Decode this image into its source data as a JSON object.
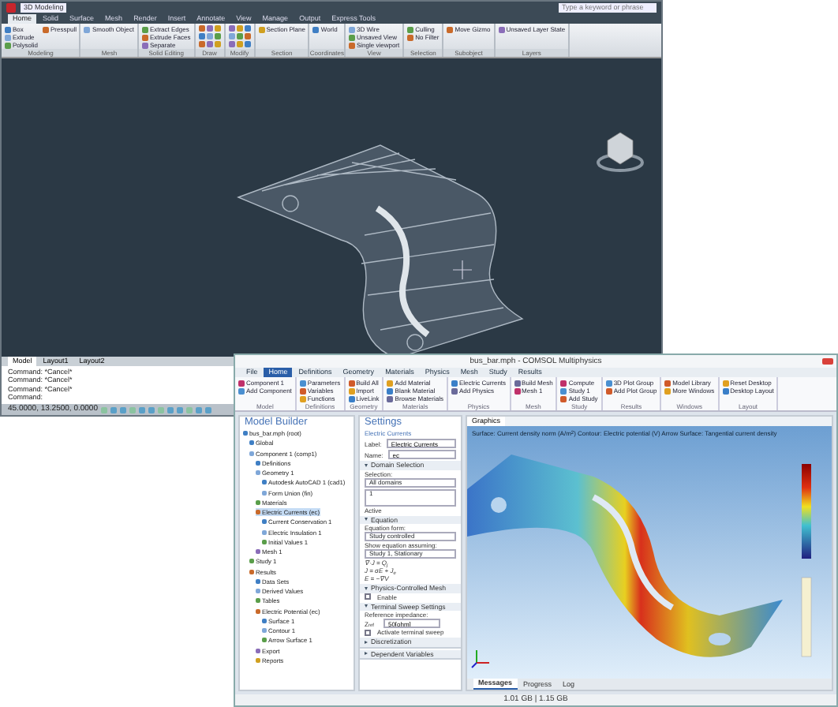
{
  "cad_window": {
    "workspace": "3D Modeling",
    "search_placeholder": "Type a keyword or phrase",
    "tabs": [
      {
        "label": "Home",
        "selected": true
      },
      {
        "label": "Solid",
        "selected": false
      },
      {
        "label": "Surface",
        "selected": false
      },
      {
        "label": "Mesh",
        "selected": false
      },
      {
        "label": "Render",
        "selected": false
      },
      {
        "label": "Insert",
        "selected": false
      },
      {
        "label": "Annotate",
        "selected": false
      },
      {
        "label": "View",
        "selected": false
      },
      {
        "label": "Manage",
        "selected": false
      },
      {
        "label": "Output",
        "selected": false
      },
      {
        "label": "Express Tools",
        "selected": false
      }
    ],
    "panels": [
      {
        "title": "Modeling",
        "tools": [
          "Box",
          "Extrude",
          "Polysolid",
          "Presspull"
        ]
      },
      {
        "title": "Mesh",
        "tools": [
          "Smooth Object"
        ]
      },
      {
        "title": "Solid Editing",
        "tools": [
          "Extract Edges",
          "Extrude Faces",
          "Separate"
        ]
      },
      {
        "title": "Draw"
      },
      {
        "title": "Modify"
      },
      {
        "title": "Section",
        "tools": [
          "Section Plane"
        ]
      },
      {
        "title": "Coordinates",
        "tools": [
          "World"
        ]
      },
      {
        "title": "View",
        "tools": [
          "3D Wire",
          "Unsaved View",
          "Single viewport"
        ]
      },
      {
        "title": "Selection",
        "tools": [
          "Culling",
          "No Filter"
        ]
      },
      {
        "title": "Subobject",
        "tools": [
          "Move Gizmo"
        ]
      },
      {
        "title": "Layers",
        "tools": [
          "Unsaved Layer State"
        ]
      }
    ],
    "layout_tabs": [
      {
        "label": "Model",
        "selected": true
      },
      {
        "label": "Layout1",
        "selected": false
      },
      {
        "label": "Layout2",
        "selected": false
      }
    ],
    "command_lines": [
      "Command:  *Cancel*",
      "Command:  *Cancel*",
      "Command:  *Cancel*",
      "Command:"
    ],
    "coordinates": "45.0000, 13.2500, 0.0000"
  },
  "sim_window": {
    "title": "bus_bar.mph - COMSOL Multiphysics",
    "tabs": [
      {
        "label": "File",
        "selected": false
      },
      {
        "label": "Home",
        "selected": true
      },
      {
        "label": "Definitions",
        "selected": false
      },
      {
        "label": "Geometry",
        "selected": false
      },
      {
        "label": "Materials",
        "selected": false
      },
      {
        "label": "Physics",
        "selected": false
      },
      {
        "label": "Mesh",
        "selected": false
      },
      {
        "label": "Study",
        "selected": false
      },
      {
        "label": "Results",
        "selected": false
      }
    ],
    "ribbon_groups": [
      {
        "title": "Model",
        "tools": [
          "Component 1",
          "Add Component"
        ]
      },
      {
        "title": "Definitions",
        "tools": [
          "Parameters",
          "Variables",
          "Functions"
        ]
      },
      {
        "title": "Geometry",
        "tools": [
          "Build All",
          "Import",
          "LiveLink"
        ]
      },
      {
        "title": "Materials",
        "tools": [
          "Add Material",
          "Blank Material",
          "Browse Materials"
        ]
      },
      {
        "title": "Physics",
        "tools": [
          "Electric Currents",
          "Add Physics"
        ]
      },
      {
        "title": "Mesh",
        "tools": [
          "Build Mesh",
          "Mesh 1"
        ]
      },
      {
        "title": "Study",
        "tools": [
          "Compute",
          "Study 1",
          "Add Study"
        ]
      },
      {
        "title": "Results",
        "tools": [
          "3D Plot Group",
          "Add Plot Group"
        ]
      },
      {
        "title": "Windows",
        "tools": [
          "Model Library",
          "More Windows"
        ]
      },
      {
        "title": "Layout",
        "tools": [
          "Reset Desktop",
          "Desktop Layout"
        ]
      }
    ],
    "model_builder": {
      "title": "Model Builder",
      "tree": [
        {
          "label": "bus_bar.mph (root)",
          "selected": false,
          "children": [
            {
              "label": "Global",
              "selected": false
            },
            {
              "label": "Component 1 (comp1)",
              "selected": false,
              "children": [
                {
                  "label": "Definitions",
                  "selected": false
                },
                {
                  "label": "Geometry 1",
                  "selected": false,
                  "children": [
                    {
                      "label": "Autodesk AutoCAD 1 (cad1)",
                      "selected": false
                    },
                    {
                      "label": "Form Union (fin)",
                      "selected": false
                    }
                  ]
                },
                {
                  "label": "Materials",
                  "selected": false
                },
                {
                  "label": "Electric Currents (ec)",
                  "selected": true,
                  "children": [
                    {
                      "label": "Current Conservation 1",
                      "selected": false
                    },
                    {
                      "label": "Electric Insulation 1",
                      "selected": false
                    },
                    {
                      "label": "Initial Values 1",
                      "selected": false
                    }
                  ]
                },
                {
                  "label": "Mesh 1",
                  "selected": false
                }
              ]
            },
            {
              "label": "Study 1",
              "selected": false
            },
            {
              "label": "Results",
              "selected": false,
              "children": [
                {
                  "label": "Data Sets",
                  "selected": false
                },
                {
                  "label": "Derived Values",
                  "selected": false
                },
                {
                  "label": "Tables",
                  "selected": false
                },
                {
                  "label": "Electric Potential (ec)",
                  "selected": false,
                  "children": [
                    {
                      "label": "Surface 1",
                      "selected": false
                    },
                    {
                      "label": "Contour 1",
                      "selected": false
                    },
                    {
                      "label": "Arrow Surface 1",
                      "selected": false
                    }
                  ]
                },
                {
                  "label": "Export",
                  "selected": false
                },
                {
                  "label": "Reports",
                  "selected": false
                }
              ]
            }
          ]
        }
      ]
    },
    "settings": {
      "title": "Settings",
      "subtitle": "Electric Currents",
      "label_caption": "Label:",
      "label_value": "Electric Currents",
      "name_caption": "Name:",
      "name_value": "ec",
      "sections": [
        {
          "title": "Domain Selection",
          "expanded": true,
          "kind": "selection",
          "caption": "Selection:",
          "value": "All domains",
          "list_item": "1",
          "list_caption": "Active"
        },
        {
          "title": "Equation",
          "expanded": true,
          "kind": "equation",
          "captions": [
            "Equation form:",
            "Show equation assuming:"
          ],
          "values": [
            "Study controlled",
            "Study 1, Stationary"
          ],
          "formulas": [
            "∇·J = Q$_{j}$",
            "J = σE + J$_{e}$",
            "E = −∇V"
          ]
        },
        {
          "title": "Physics-Controlled Mesh",
          "expanded": true,
          "kind": "check",
          "checks": [
            {
              "label": "Enable",
              "checked": false
            }
          ]
        },
        {
          "title": "Terminal Sweep Settings",
          "expanded": true,
          "kind": "impedance",
          "caption": "Reference impedance:",
          "symbol": "Z$_{ref}$",
          "value": "50[ohm]",
          "checks": [
            {
              "label": "Activate terminal sweep",
              "checked": false
            }
          ]
        },
        {
          "title": "Discretization",
          "expanded": false,
          "kind": "closed"
        },
        {
          "title": "Dependent Variables",
          "expanded": false,
          "kind": "closed"
        }
      ]
    },
    "graphics": {
      "tab": "Graphics",
      "plot_title": "Surface: Current density norm (A/m$^{2}$)  Contour: Electric potential (V)  Arrow Surface: Tangential current density"
    },
    "bottom_tabs": [
      {
        "label": "Messages",
        "selected": true
      },
      {
        "label": "Progress",
        "selected": false
      },
      {
        "label": "Log",
        "selected": false
      }
    ],
    "memory": "1.01 GB | 1.15 GB"
  }
}
